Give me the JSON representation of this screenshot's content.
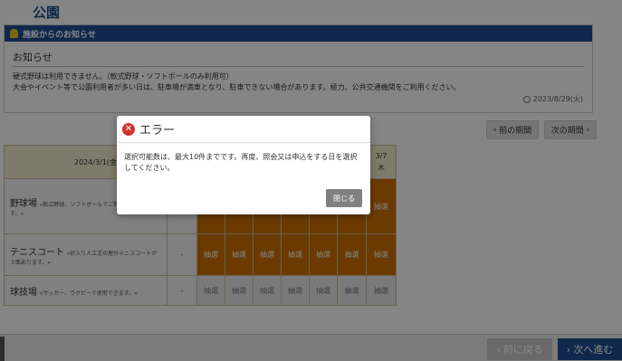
{
  "page": {
    "title": "公園"
  },
  "notice": {
    "header": "施設からのお知らせ",
    "subtitle": "お知らせ",
    "line1": "硬式野球は利用できません。（軟式野球・ソフトボールのみ利用可）",
    "line2": "大会やイベント等で公園利用者が多い日は、駐車場が満車となり、駐車できない場合があります。極力、公共交通機関をご利用ください。",
    "date": "2023/8/29(火)"
  },
  "period": {
    "prev_label": "前の期間",
    "next_label": "次の期間"
  },
  "grid": {
    "range_label": "2024/3/1(金)〜",
    "last_day": {
      "date": "3/7",
      "weekday": "木"
    },
    "facilities": [
      {
        "name": "野球場",
        "note": "«軟式野球、ソフトボールでご利用いただけます。»",
        "dash": "",
        "cells": [
          "",
          "",
          "",
          "",
          "",
          "",
          "抽選"
        ],
        "style": "orange"
      },
      {
        "name": "テニスコート",
        "note": "«砂入り人工芝の屋外テニスコートが３面あります。»",
        "dash": "-",
        "cells": [
          "抽選",
          "抽選",
          "抽選",
          "抽選",
          "抽選",
          "抽選",
          "抽選"
        ],
        "style": "orange"
      },
      {
        "name": "球技場",
        "note": "«サッカー、ラグビーで使用できます。»",
        "dash": "-",
        "cells": [
          "抽選",
          "抽選",
          "抽選",
          "抽選",
          "抽選",
          "抽選",
          "抽選"
        ],
        "style": "grey"
      }
    ]
  },
  "footer": {
    "back_label": "前に戻る",
    "next_label": "次へ進む"
  },
  "modal": {
    "title": "エラー",
    "message": "選択可能数は、最大10件までです。再度、照会又は申込をする日を選択してください。",
    "close_label": "閉じる"
  },
  "colors": {
    "brand": "#1d4e93",
    "lottery": "#cc7000",
    "error": "#d0322f"
  }
}
